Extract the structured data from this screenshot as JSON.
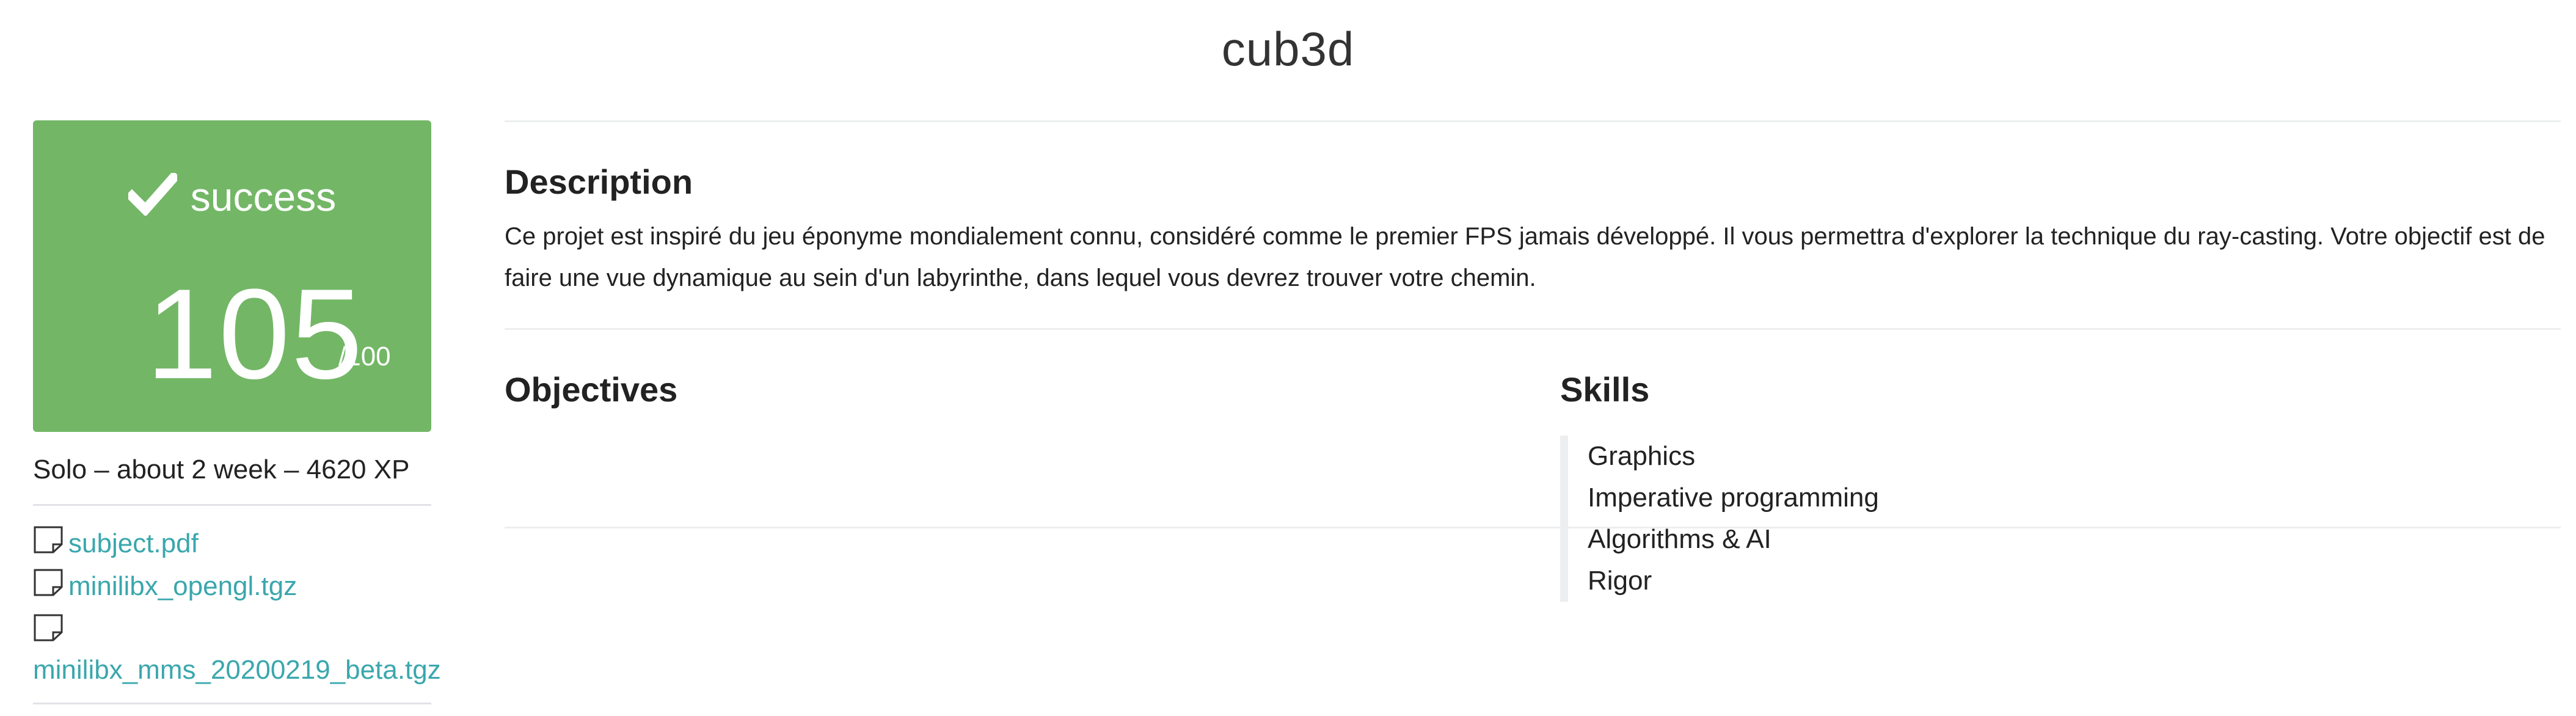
{
  "page": {
    "title": "cub3d"
  },
  "status": {
    "label": "success",
    "score": "105",
    "max": "/100",
    "color": "#73b766",
    "icon": "checkmark-icon"
  },
  "meta": {
    "line": "Solo – about 2 week – 4620 XP"
  },
  "files": [
    {
      "name": "subject.pdf",
      "icon": "document-icon"
    },
    {
      "name": "minilibx_opengl.tgz",
      "icon": "document-icon"
    },
    {
      "name": "minilibx_mms_20200219_beta.tgz",
      "icon": "document-icon"
    }
  ],
  "description": {
    "title": "Description",
    "text": "Ce projet est inspiré du jeu éponyme mondialement connu, considéré comme le premier FPS jamais développé. Il vous permettra d'explorer la technique du ray-casting. Votre objectif est de faire une vue dynamique au sein d'un labyrinthe, dans lequel vous devrez trouver votre chemin."
  },
  "objectives": {
    "title": "Objectives"
  },
  "skills": {
    "title": "Skills",
    "items": [
      "Graphics",
      "Imperative programming",
      "Algorithms & AI",
      "Rigor"
    ]
  },
  "colors": {
    "link": "#3aa7ad",
    "divider": "#e1e3e6"
  }
}
